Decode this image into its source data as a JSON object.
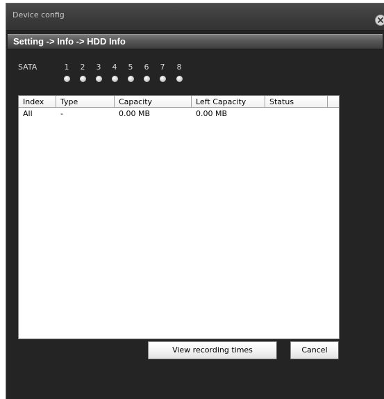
{
  "window": {
    "title": "Device config"
  },
  "breadcrumb": "Setting -> Info -> HDD Info",
  "sata": {
    "label": "SATA",
    "ports": [
      "1",
      "2",
      "3",
      "4",
      "5",
      "6",
      "7",
      "8"
    ]
  },
  "table": {
    "columns": [
      "Index",
      "Type",
      "Capacity",
      "Left Capacity",
      "Status"
    ],
    "rows": [
      [
        "All",
        "-",
        "0.00 MB",
        "0.00 MB",
        ""
      ]
    ]
  },
  "buttons": {
    "view_recording_times": "View recording times",
    "cancel": "Cancel"
  },
  "icons": {
    "close": "close-icon",
    "port_led": "led-indicator-icon"
  },
  "colors": {
    "window_bg": "#242424",
    "led": "#cfcfcf"
  }
}
